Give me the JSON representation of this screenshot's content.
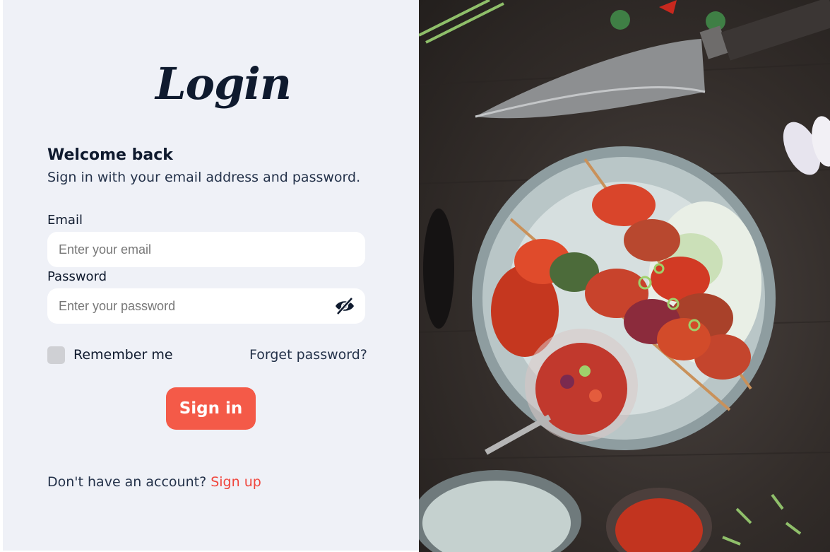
{
  "login": {
    "logo_text": "Login",
    "welcome": "Welcome back",
    "subtitle": "Sign in with your email address and password.",
    "email_label": "Email",
    "email_placeholder": "Enter your email",
    "password_label": "Password",
    "password_placeholder": "Enter your password",
    "remember_label": "Remember me",
    "remember_checked": false,
    "forgot_label": "Forget password?",
    "signin_label": "Sign in",
    "signup_prompt": "Don't have an account?",
    "signup_link": "Sign up"
  },
  "theme": {
    "accent": "#f45a48",
    "panel_bg": "#eff1f7",
    "text_dark": "#0f1a2e"
  },
  "icons": {
    "password_toggle": "eye-off-icon"
  }
}
